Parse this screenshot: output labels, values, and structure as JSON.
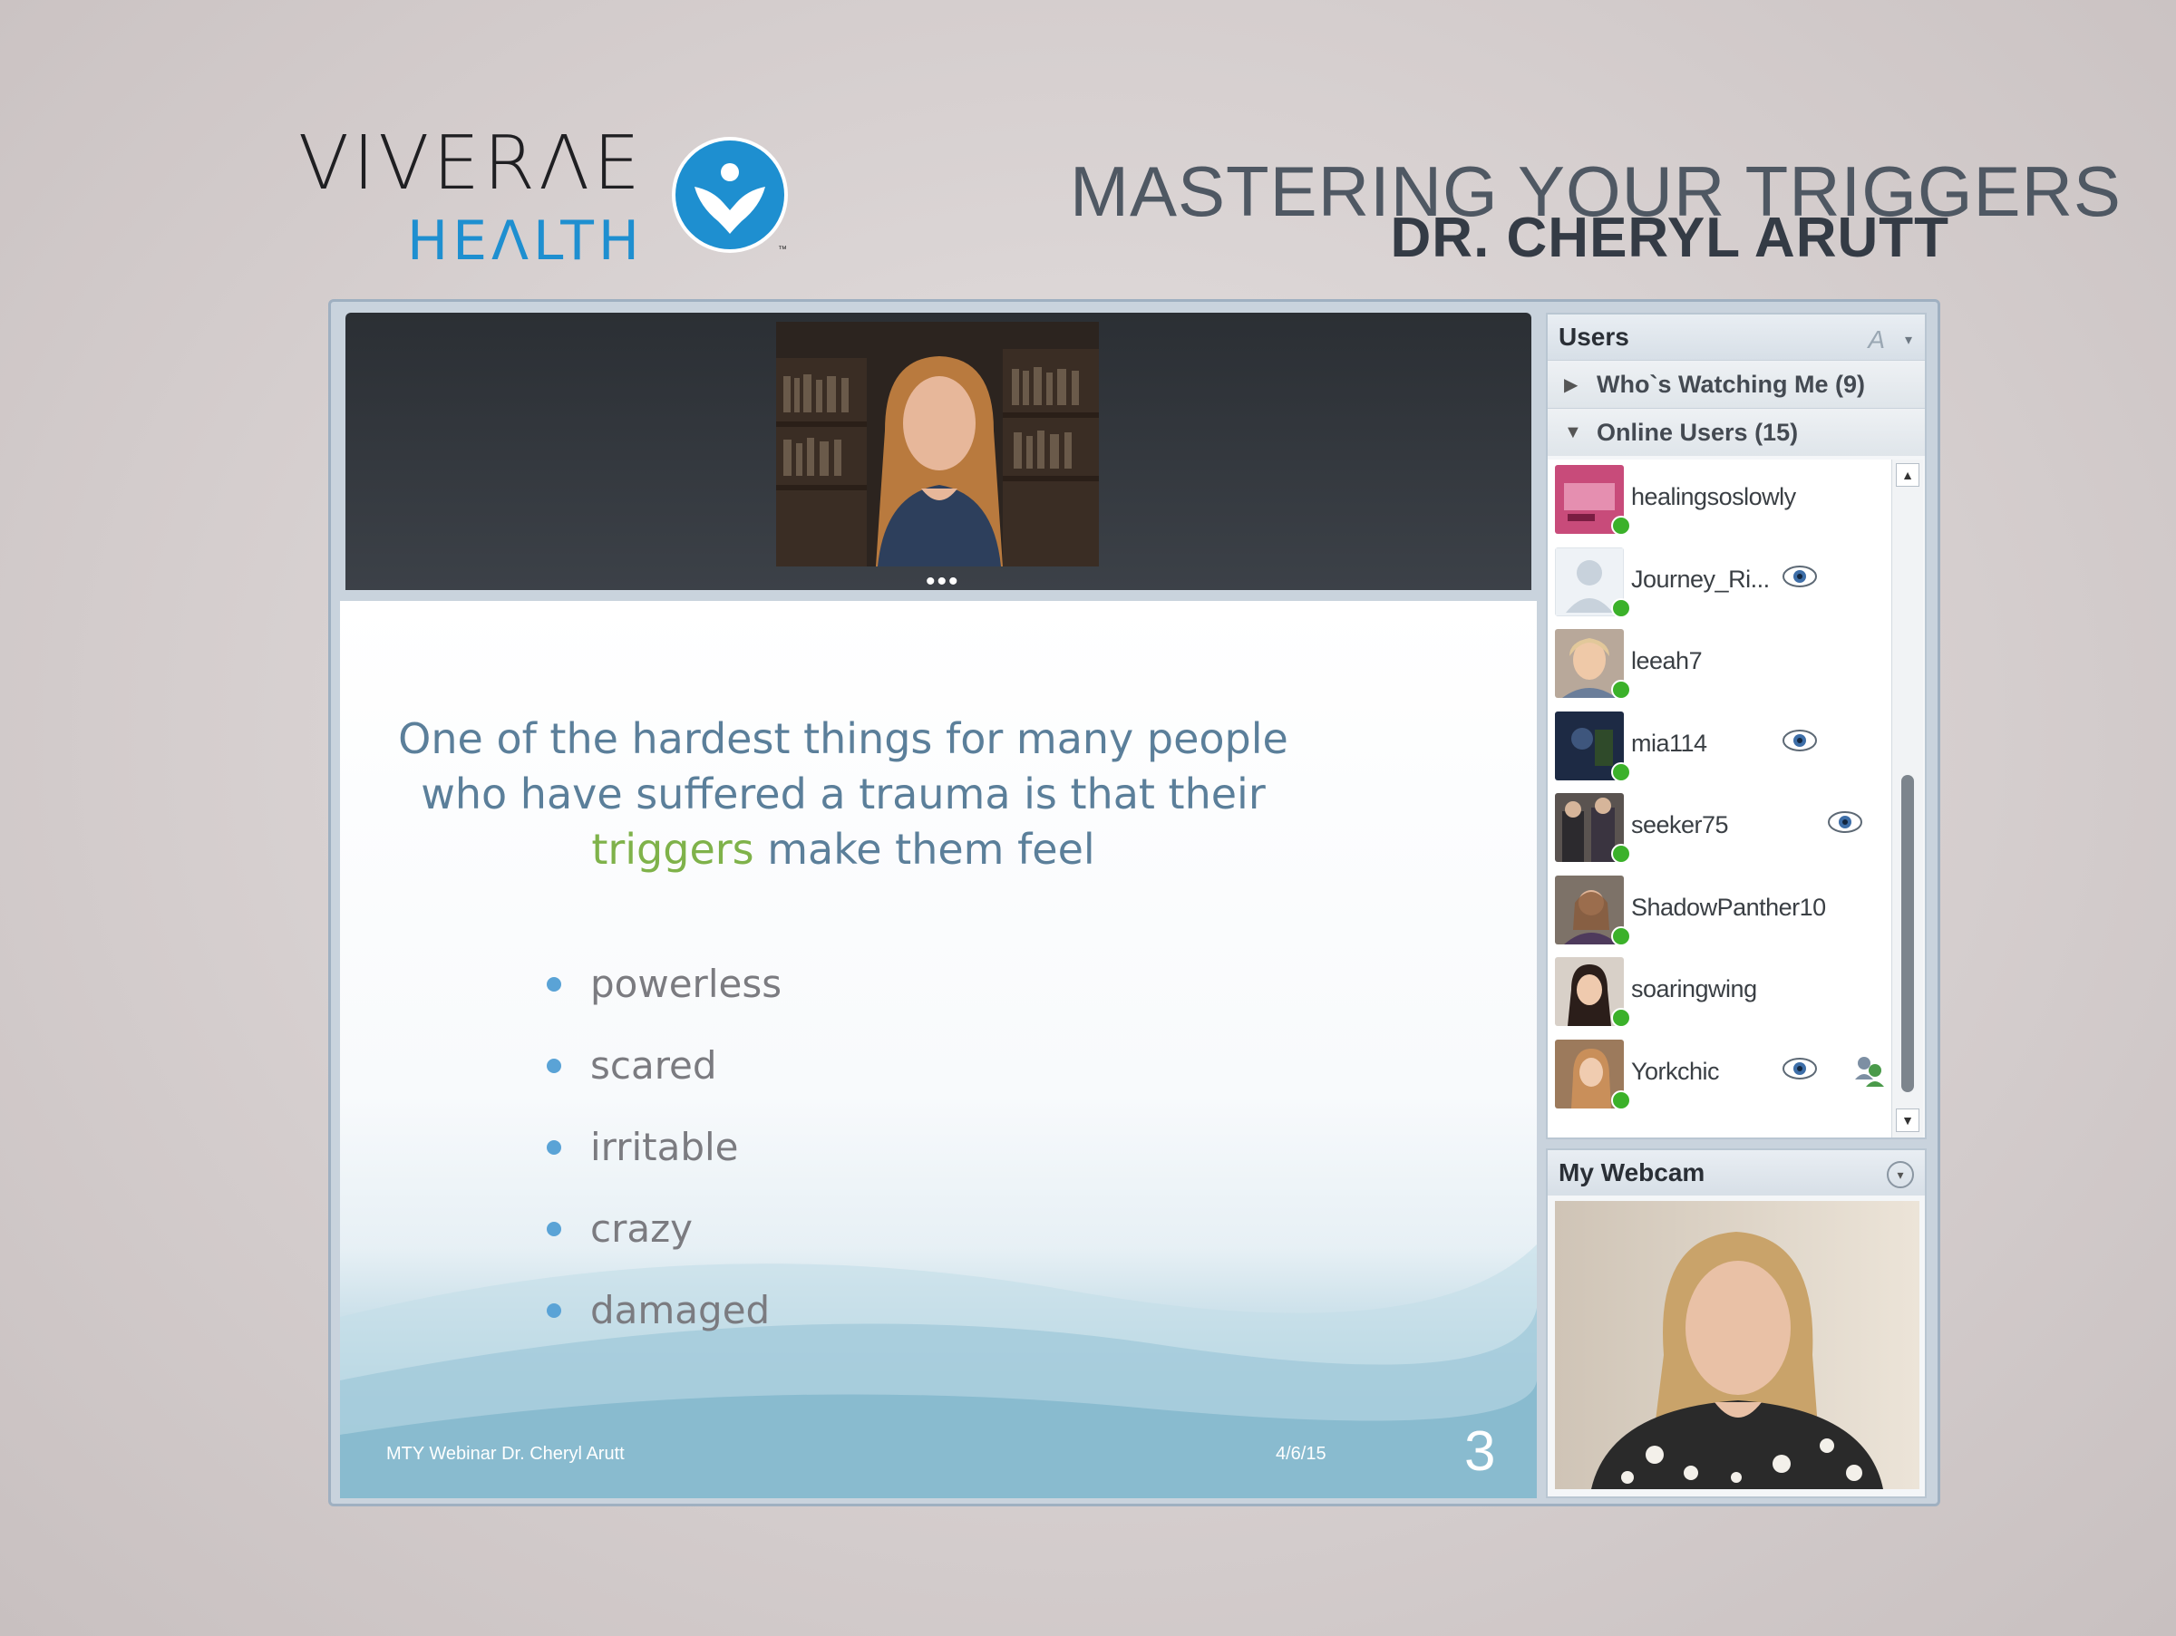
{
  "brand": {
    "line1": "VIVERΛE",
    "line2": "HEΛLTH",
    "trademark": "™",
    "blue": "#1e8fd0"
  },
  "title": {
    "main": "MASTERING YOUR TRIGGERS",
    "sub": "DR. CHERYL ARUTT"
  },
  "video": {
    "more_label": "•••"
  },
  "slide": {
    "line1": "One of  the hardest things for many people",
    "line2": "who have suffered a trauma is that their",
    "highlight": "triggers",
    "line3_rest": " make them feel",
    "bullets": [
      "powerless",
      "scared",
      "irritable",
      "crazy",
      "damaged"
    ],
    "footer_left": "MTY Webinar Dr. Cheryl Arutt",
    "footer_date": "4/6/15",
    "page_number": "3",
    "text_color": "#5b7f9a",
    "highlight_color": "#7fb24a"
  },
  "users_panel": {
    "title": "Users",
    "font_icon": "A",
    "menu_icon": "▾",
    "groups": [
      {
        "label": "Who`s Watching Me (9)",
        "expanded": false,
        "arrow": "▶"
      },
      {
        "label": "Online Users (15)",
        "expanded": true,
        "arrow": "▼"
      }
    ],
    "users": [
      {
        "name": "healingsoslowly",
        "watching": false,
        "sharing": false
      },
      {
        "name": "Journey_Ri...",
        "watching": true,
        "sharing": false
      },
      {
        "name": "leeah7",
        "watching": false,
        "sharing": false
      },
      {
        "name": "mia114",
        "watching": true,
        "sharing": false
      },
      {
        "name": "seeker75",
        "watching": true,
        "sharing": false
      },
      {
        "name": "ShadowPanther10",
        "watching": false,
        "sharing": false
      },
      {
        "name": "soaringwing",
        "watching": false,
        "sharing": false
      },
      {
        "name": "Yorkchic",
        "watching": true,
        "sharing": true
      }
    ],
    "online_color": "#3bb12a"
  },
  "webcam_panel": {
    "title": "My Webcam",
    "menu_icon": "▾"
  }
}
